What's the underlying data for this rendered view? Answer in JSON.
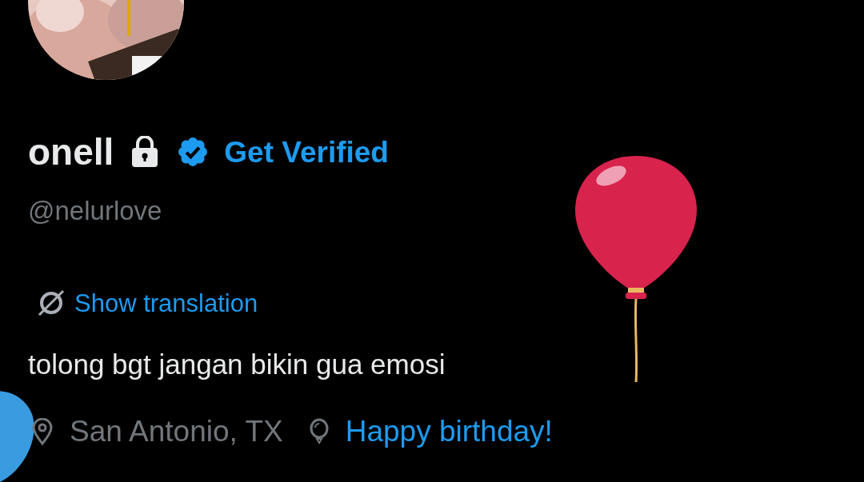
{
  "profile": {
    "name": "onell",
    "protected": true,
    "verified": true,
    "get_verified": "Get Verified",
    "handle": "@nelurlove",
    "show_translation": "Show translation",
    "bio": "tolong bgt jangan bikin gua emosi",
    "location": "San Antonio, TX",
    "birthday": "Happy birthday!"
  }
}
